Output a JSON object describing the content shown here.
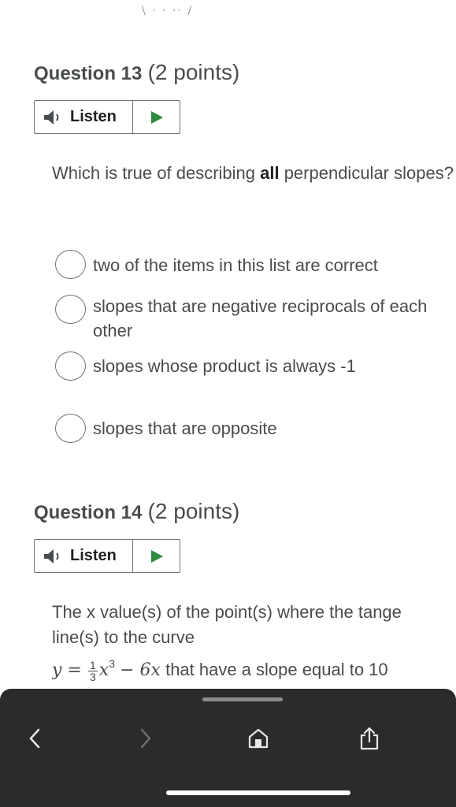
{
  "top_fragment": "\\ · · ·· /",
  "q13": {
    "title": "Question 13",
    "points": "(2 points)",
    "listen_label": "Listen",
    "text_before": "Which is true of describing ",
    "text_bold": "all",
    "text_after": " perpendicular slopes?",
    "options": [
      "two of the items in this list are correct",
      "slopes that are negative reciprocals of each other",
      "slopes whose product is always -1",
      "slopes that are opposite"
    ]
  },
  "q14": {
    "title": "Question 14",
    "points": "(2 points)",
    "listen_label": "Listen",
    "line1": "The x value(s) of the point(s) where the tange",
    "line2": "line(s) to the curve",
    "eq_lhs": "y =",
    "eq_num": "1",
    "eq_den": "3",
    "eq_x": "x",
    "eq_exp": "3",
    "eq_rest": "− 6x",
    "line3_tail": " that have a slope equal to 10"
  },
  "browser": {
    "back_icon": "chevron-left-icon",
    "forward_icon": "chevron-right-icon",
    "home_icon": "home-icon",
    "share_icon": "share-icon"
  }
}
